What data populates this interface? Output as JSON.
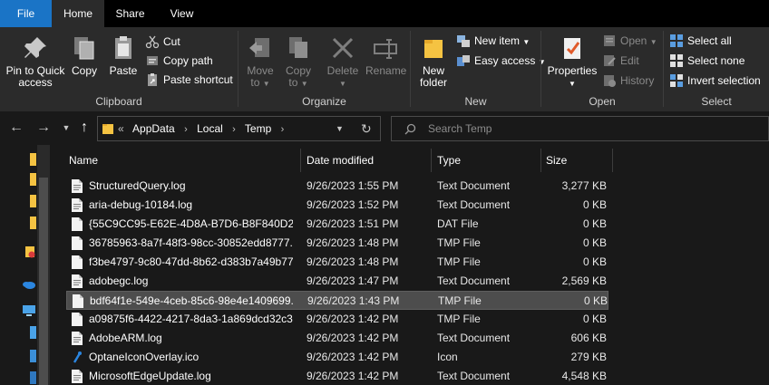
{
  "tabs": {
    "file": "File",
    "home": "Home",
    "share": "Share",
    "view": "View"
  },
  "ribbon": {
    "clipboard": {
      "label": "Clipboard",
      "pin_to_quick_access": "Pin to Quick",
      "pin_to_quick_access_2": "access",
      "copy": "Copy",
      "paste": "Paste",
      "cut": "Cut",
      "copy_path": "Copy path",
      "paste_shortcut": "Paste shortcut"
    },
    "organize": {
      "label": "Organize",
      "move_to": "Move",
      "move_to_2": "to",
      "copy_to": "Copy",
      "copy_to_2": "to",
      "delete": "Delete",
      "rename": "Rename"
    },
    "new": {
      "label": "New",
      "new_folder": "New",
      "new_folder_2": "folder",
      "new_item": "New item",
      "easy_access": "Easy access"
    },
    "open": {
      "label": "Open",
      "properties": "Properties",
      "open": "Open",
      "edit": "Edit",
      "history": "History"
    },
    "select": {
      "label": "Select",
      "select_all": "Select all",
      "select_none": "Select none",
      "invert_selection": "Invert selection"
    }
  },
  "address": {
    "overflow": "«",
    "crumbs": [
      "AppData",
      "Local",
      "Temp"
    ],
    "search_placeholder": "Search Temp"
  },
  "columns": {
    "name": "Name",
    "date_modified": "Date modified",
    "type": "Type",
    "size": "Size"
  },
  "files": [
    {
      "name": "StructuredQuery.log",
      "date": "9/26/2023 1:55 PM",
      "type": "Text Document",
      "size": "3,277 KB",
      "icon": "text-file-icon",
      "selected": false
    },
    {
      "name": "aria-debug-10184.log",
      "date": "9/26/2023 1:52 PM",
      "type": "Text Document",
      "size": "0 KB",
      "icon": "text-file-icon",
      "selected": false
    },
    {
      "name": "{55C9CC95-E62E-4D8A-B7D6-B8F840D2D...",
      "date": "9/26/2023 1:51 PM",
      "type": "DAT File",
      "size": "0 KB",
      "icon": "blank-file-icon",
      "selected": false
    },
    {
      "name": "36785963-8a7f-48f3-98cc-30852edd8777.t...",
      "date": "9/26/2023 1:48 PM",
      "type": "TMP File",
      "size": "0 KB",
      "icon": "blank-file-icon",
      "selected": false
    },
    {
      "name": "f3be4797-9c80-47dd-8b62-d383b7a49b77...",
      "date": "9/26/2023 1:48 PM",
      "type": "TMP File",
      "size": "0 KB",
      "icon": "blank-file-icon",
      "selected": false
    },
    {
      "name": "adobegc.log",
      "date": "9/26/2023 1:47 PM",
      "type": "Text Document",
      "size": "2,569 KB",
      "icon": "text-file-icon",
      "selected": false
    },
    {
      "name": "bdf64f1e-549e-4ceb-85c6-98e4e1409699....",
      "date": "9/26/2023 1:43 PM",
      "type": "TMP File",
      "size": "0 KB",
      "icon": "blank-file-icon",
      "selected": true
    },
    {
      "name": "a09875f6-4422-4217-8da3-1a869dcd32c3....",
      "date": "9/26/2023 1:42 PM",
      "type": "TMP File",
      "size": "0 KB",
      "icon": "blank-file-icon",
      "selected": false
    },
    {
      "name": "AdobeARM.log",
      "date": "9/26/2023 1:42 PM",
      "type": "Text Document",
      "size": "606 KB",
      "icon": "text-file-icon",
      "selected": false
    },
    {
      "name": "OptaneIconOverlay.ico",
      "date": "9/26/2023 1:42 PM",
      "type": "Icon",
      "size": "279 KB",
      "icon": "ico-file-icon",
      "selected": false
    },
    {
      "name": "MicrosoftEdgeUpdate.log",
      "date": "9/26/2023 1:42 PM",
      "type": "Text Document",
      "size": "4,548 KB",
      "icon": "text-file-icon",
      "selected": false
    }
  ],
  "colors": {
    "file_tab": "#1a74c6",
    "ribbon_bg": "#2b2b2b",
    "window_bg": "#191919",
    "selection": "#4d4d4d",
    "folder": "#f5c342"
  }
}
